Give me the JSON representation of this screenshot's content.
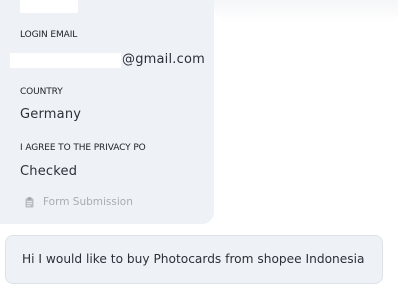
{
  "form": {
    "fields": [
      {
        "label": "LOGIN EMAIL",
        "value_suffix": "@gmail.com"
      },
      {
        "label": "COUNTRY",
        "value": "Germany"
      },
      {
        "label": "I AGREE TO THE PRIVACY PO",
        "value": "Checked"
      }
    ],
    "footer": {
      "icon": "clipboard-icon",
      "label": "Form Submission"
    }
  },
  "message": {
    "text": "Hi I would like to buy Photocards from shopee Indonesia"
  },
  "colors": {
    "card_background": "#eef2f6",
    "text_primary": "#2b3038",
    "text_muted": "#a7acb3",
    "bubble_border": "#dde2e8"
  }
}
